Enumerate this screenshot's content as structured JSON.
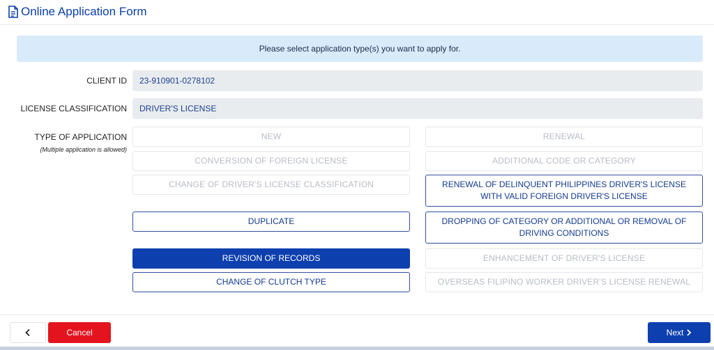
{
  "header": {
    "title": "Online Application Form",
    "icon": "document-icon"
  },
  "banner": {
    "text": "Please select application type(s) you want to apply for."
  },
  "client_id": {
    "label": "CLIENT ID",
    "value": "23-910901-0278102"
  },
  "license_classification": {
    "label": "LICENSE CLASSIFICATION",
    "value": "DRIVER'S LICENSE"
  },
  "application_type": {
    "label": "TYPE OF APPLICATION",
    "sublabel": "(Multiple application is allowed)",
    "options": [
      {
        "label": "NEW",
        "state": "disabled"
      },
      {
        "label": "RENEWAL",
        "state": "disabled"
      },
      {
        "label": "CONVERSION OF FOREIGN LICENSE",
        "state": "disabled"
      },
      {
        "label": "ADDITIONAL CODE OR CATEGORY",
        "state": "disabled"
      },
      {
        "label": "CHANGE OF DRIVER'S LICENSE CLASSIFICATION",
        "state": "disabled"
      },
      {
        "label": "RENEWAL OF DELINQUENT PHILIPPINES DRIVER'S LICENSE WITH VALID FOREIGN DRIVER'S LICENSE",
        "state": "available"
      },
      {
        "label": "DUPLICATE",
        "state": "available"
      },
      {
        "label": "DROPPING OF CATEGORY OR ADDITIONAL OR REMOVAL OF DRIVING CONDITIONS",
        "state": "available"
      },
      {
        "label": "REVISION OF RECORDS",
        "state": "selected"
      },
      {
        "label": "ENHANCEMENT OF DRIVER'S LICENSE",
        "state": "disabled"
      },
      {
        "label": "CHANGE OF CLUTCH TYPE",
        "state": "available"
      },
      {
        "label": "OVERSEAS FILIPINO WORKER DRIVER'S LICENSE RENEWAL",
        "state": "disabled"
      }
    ]
  },
  "footer": {
    "back_icon": "chevron-left-icon",
    "cancel_label": "Cancel",
    "next_label": "Next",
    "next_icon": "chevron-right-icon"
  },
  "colors": {
    "primary": "#0d3fae",
    "danger": "#e4141f",
    "banner": "#d9ebfb",
    "field": "#e9ecef"
  }
}
